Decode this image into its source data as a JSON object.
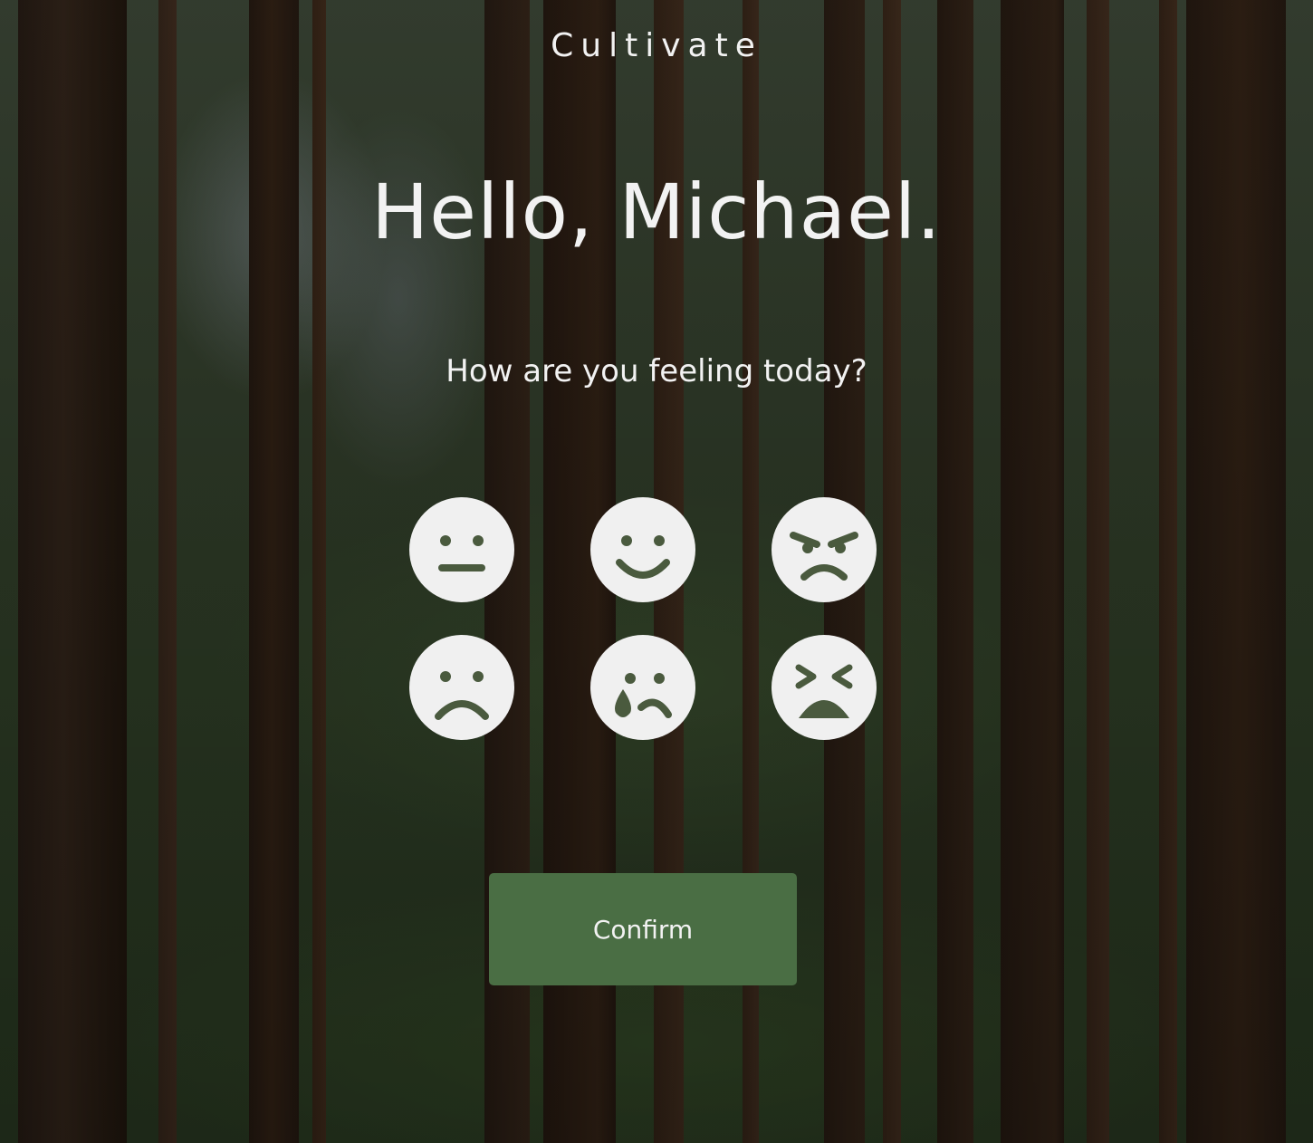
{
  "app": {
    "brand": "Cultivate"
  },
  "main": {
    "greeting": "Hello, Michael.",
    "question": "How are you feeling today?",
    "moods": [
      {
        "icon": "neutral-face-icon"
      },
      {
        "icon": "smiling-face-icon"
      },
      {
        "icon": "angry-face-icon"
      },
      {
        "icon": "sad-face-icon"
      },
      {
        "icon": "crying-face-icon"
      },
      {
        "icon": "tired-face-icon"
      }
    ],
    "confirm_label": "Confirm"
  },
  "colors": {
    "button": "#4a6e44",
    "face": "#f0f0f0",
    "feature": "#4a5a3e",
    "text": "#f2f2f2"
  }
}
